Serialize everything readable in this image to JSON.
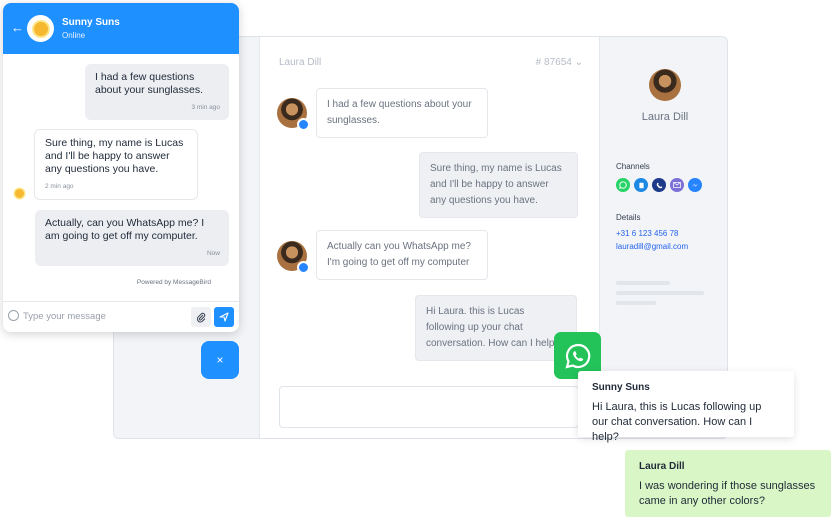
{
  "widget": {
    "header": {
      "title": "Sunny Suns",
      "status": "Online",
      "back_glyph": "←"
    },
    "messages": [
      {
        "text": "I had a few questions about your sunglasses.",
        "time": "3 min ago"
      },
      {
        "text": "Sure thing, my name is Lucas and I'll be happy to answer any questions you have.",
        "time": "2 min ago"
      },
      {
        "text": "Actually, can you WhatsApp me? I am going to get off my computer.",
        "time": "Now"
      }
    ],
    "powered_by": "Powered by MessageBird",
    "input": {
      "placeholder": "Type your message"
    },
    "close_glyph": "×"
  },
  "conversation": {
    "contact": "Laura Dill",
    "ticket": "# 87654",
    "ticket_caret": "⌄",
    "messages": [
      {
        "text": "I had a few questions about your sunglasses."
      },
      {
        "text": "Sure thing, my name is Lucas and I'll be happy to answer any questions you have."
      },
      {
        "text": "Actually can you WhatsApp me? I'm going to get off my computer"
      },
      {
        "text": "Hi Laura. this is Lucas following up your chat conversation. How can I help?"
      }
    ]
  },
  "contact_panel": {
    "name": "Laura Dill",
    "channels_label": "Channels",
    "channels": [
      {
        "icon": "whatsapp-icon",
        "color": "#25d366"
      },
      {
        "icon": "sms-icon",
        "color": "#1e88e5"
      },
      {
        "icon": "phone-icon",
        "color": "#1e3a8a"
      },
      {
        "icon": "email-icon",
        "color": "#7c6fd6"
      },
      {
        "icon": "messenger-icon",
        "color": "#2684ff"
      }
    ],
    "details_label": "Details",
    "phone": "+31 6 123 456 78",
    "email": "lauradill@gmail.com"
  },
  "whatsapp_cards": {
    "agent": {
      "name": "Sunny Suns",
      "text": "Hi Laura, this is Lucas following up our chat conversation. How can I help?"
    },
    "customer": {
      "name": "Laura Dill",
      "text": "I was wondering if those sunglasses came in any other colors?"
    }
  },
  "colors": {
    "accent": "#1e90ff",
    "whatsapp": "#23c35a",
    "customer_bubble": "#d9f7c6"
  }
}
